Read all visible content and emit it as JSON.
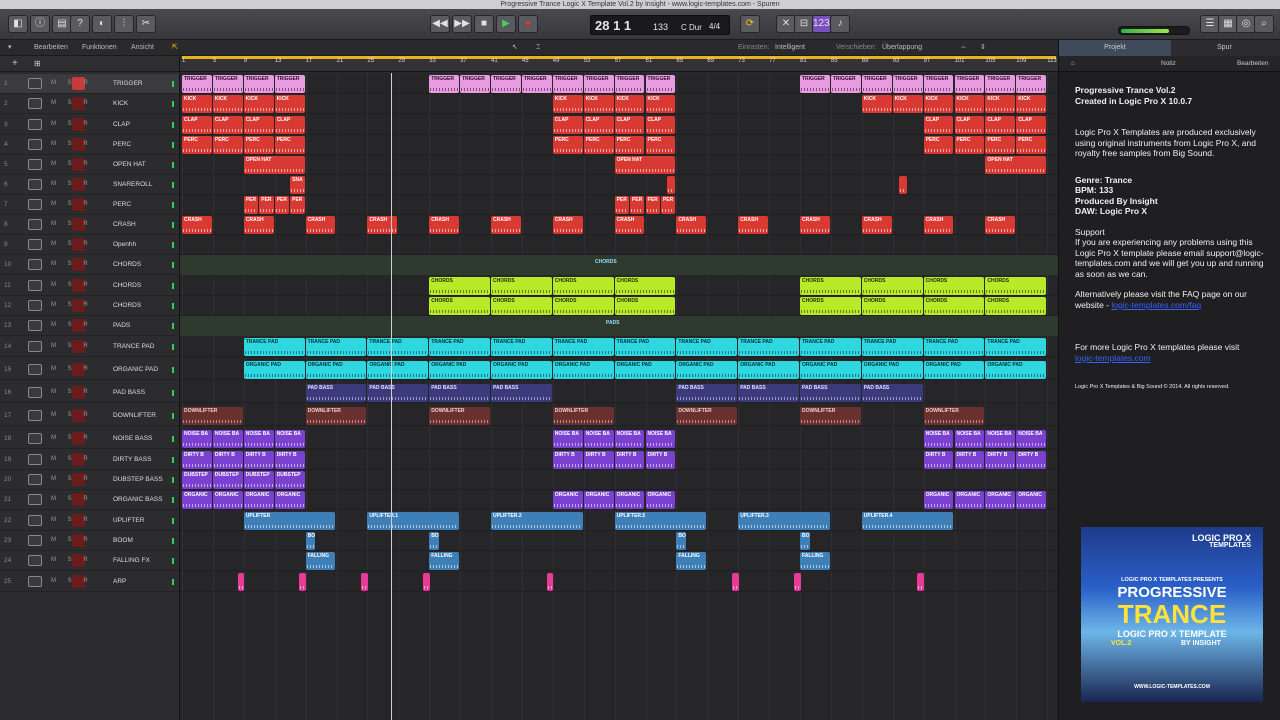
{
  "window": {
    "title": "Progressive Trance Logic X Template Vol.2 by Insight - www.logic-templates.com - Spuren"
  },
  "lcd": {
    "position": "28 1  1",
    "tempo": "133",
    "key": "C Dur",
    "sig": "4/4"
  },
  "menu": {
    "edit": "Bearbeiten",
    "functions": "Funktionen",
    "view": "Ansicht",
    "snap_label": "Einrasten:",
    "snap_value": "Intelligent",
    "drag_label": "Verschieben:",
    "drag_value": "Überlappung"
  },
  "ruler_ticks": [
    "1",
    "5",
    "9",
    "13",
    "17",
    "21",
    "25",
    "29",
    "33",
    "37",
    "41",
    "45",
    "49",
    "53",
    "57",
    "61",
    "65",
    "69",
    "73",
    "77",
    "81",
    "85",
    "89",
    "93",
    "97",
    "101",
    "105",
    "109",
    "113"
  ],
  "tracks": [
    {
      "n": "1",
      "name": "TRIGGER"
    },
    {
      "n": "2",
      "name": "KICK"
    },
    {
      "n": "3",
      "name": "CLAP"
    },
    {
      "n": "4",
      "name": "PERC"
    },
    {
      "n": "5",
      "name": "OPEN HAT"
    },
    {
      "n": "6",
      "name": "SNAREROLL"
    },
    {
      "n": "7",
      "name": "PERC"
    },
    {
      "n": "8",
      "name": "CRASH"
    },
    {
      "n": "9",
      "name": "Openhh"
    },
    {
      "n": "10",
      "name": "CHORDS"
    },
    {
      "n": "11",
      "name": "CHORDS"
    },
    {
      "n": "12",
      "name": "CHORDS"
    },
    {
      "n": "13",
      "name": "PADS"
    },
    {
      "n": "14",
      "name": "TRANCE PAD"
    },
    {
      "n": "15",
      "name": "ORGANIC PAD"
    },
    {
      "n": "16",
      "name": "PAD BASS"
    },
    {
      "n": "17",
      "name": "DOWNLIFTER"
    },
    {
      "n": "18",
      "name": "NOISE BASS"
    },
    {
      "n": "19",
      "name": "DIRTY BASS"
    },
    {
      "n": "20",
      "name": "DUBSTEP BASS"
    },
    {
      "n": "21",
      "name": "ORGANIC BASS"
    },
    {
      "n": "22",
      "name": "UPLIFTER"
    },
    {
      "n": "23",
      "name": "BOOM"
    },
    {
      "n": "24",
      "name": "FALLING FX"
    },
    {
      "n": "25",
      "name": "ARP"
    }
  ],
  "track_button_labels": "M S R",
  "folder_labels": {
    "chords": "CHORDS",
    "pads": "PADS"
  },
  "region_labels": {
    "trigger": "TRIGGER",
    "kick": "KICK",
    "clap": "CLAP",
    "perc": "PERC",
    "openhat": "OPEN HAT",
    "sna": "SNA",
    "per": "PER",
    "crash": "CRASH",
    "chords": "CHORDS",
    "trancepad": "TRANCE PAD",
    "organicpad": "ORGANIC PAD",
    "padbass": "PAD BASS",
    "downlifter": "DOWNLIFTER",
    "noisebass": "NOISE BA",
    "dirtybass": "DIRTY B",
    "dubstep": "DUBSTEP",
    "organic": "ORGANIC",
    "uplifter": "UPLIFTER",
    "uplifter1": "UPLIFTER.1",
    "uplifter2": "UPLIFTER.2",
    "uplifter3": "UPLIFTER.3",
    "uplifter4": "UPLIFTER.4",
    "uplifter5": "UPLIFTER.5",
    "boom": "BO",
    "falling": "FALLING"
  },
  "inspector": {
    "tab_project": "Projekt",
    "tab_track": "Spur",
    "sub_note": "Notiz",
    "sub_edit": "Bearbeiten",
    "title1": "Progressive Trance Vol.2",
    "title2": "Created in Logic Pro X 10.0.7",
    "intro": "Logic Pro X Templates are produced exclusively using original instruments from Logic Pro X, and royalty free samples from Big Sound.",
    "genre": "Genre: Trance",
    "bpm": "BPM: 133",
    "producer": "Produced By Insight",
    "daw": "DAW: Logic Pro X",
    "support_h": "Support",
    "support": "If you are experiencing any problems using this Logic Pro X template please email support@logic-templates.com and we will get you up and running as soon as we can.",
    "faq": "Alternatively please visit the FAQ page on our website - ",
    "faq_link": "logic-templates.com/faq",
    "more": "For more Logic Pro X templates please visit",
    "more_link": "logic-templates.com",
    "copyright": "Logic Pro X Templates & Big Sound © 2014. All rights reserved."
  },
  "cover": {
    "brand_top": "LOGIC PRO X",
    "brand_top2": "TEMPLATES",
    "presents": "LOGIC PRO X TEMPLATES PRESENTS",
    "line1": "PROGRESSIVE",
    "line2": "TRANCE",
    "line3": "LOGIC PRO X TEMPLATE",
    "vol": "VOL.2",
    "by": "BY INSIGHT",
    "url": "WWW.LOGIC-TEMPLATES.COM"
  }
}
